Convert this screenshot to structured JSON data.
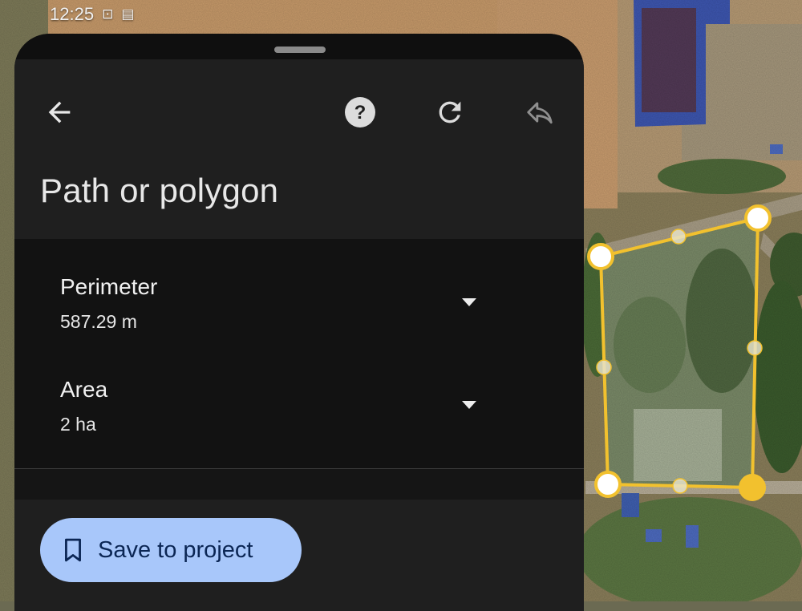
{
  "status_bar": {
    "time": "12:25",
    "icons": [
      "screen-record-icon",
      "notification-icon"
    ]
  },
  "sheet": {
    "header": {
      "back_icon": "back-arrow-icon",
      "help_icon": "help-icon",
      "redo_icon": "redo-icon",
      "undo_icon": "undo-icon",
      "title": "Path or polygon"
    },
    "measurements": [
      {
        "label": "Perimeter",
        "value": "587.29 m"
      },
      {
        "label": "Area",
        "value": "2 ha"
      }
    ],
    "save_button": {
      "icon": "bookmark-icon",
      "label": "Save to project"
    }
  },
  "map": {
    "polygon": {
      "color": "#f2c12e",
      "vertex_count": 4,
      "midpoint_count": 4
    }
  }
}
